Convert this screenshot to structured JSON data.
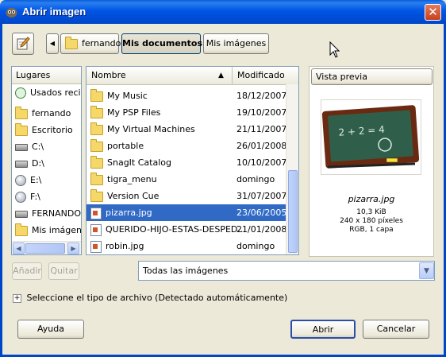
{
  "window": {
    "title": "Abrir imagen",
    "close_symbol": "✕"
  },
  "pathbar": {
    "back_arrow": "◀",
    "crumbs": [
      "fernando",
      "Mis documentos",
      "Mis imágenes"
    ]
  },
  "places": {
    "header": "Lugares",
    "items": [
      {
        "label": "Usados recien",
        "icon": "recent-icon"
      },
      {
        "label": "fernando",
        "icon": "folder-icon"
      },
      {
        "label": "Escritorio",
        "icon": "folder-icon"
      },
      {
        "label": "C:\\",
        "icon": "drive-icon"
      },
      {
        "label": "D:\\",
        "icon": "drive-icon"
      },
      {
        "label": "E:\\",
        "icon": "network-drive-icon"
      },
      {
        "label": "F:\\",
        "icon": "network-drive-icon"
      },
      {
        "label": "FERNANDO (C",
        "icon": "drive-icon"
      },
      {
        "label": "Mis imágenes",
        "icon": "folder-icon"
      }
    ],
    "add_button": "Añadir",
    "remove_button": "Quitar"
  },
  "files": {
    "col_name": "Nombre",
    "col_modified": "Modificado",
    "sort_arrow": "▲",
    "rows": [
      {
        "name": "My Music",
        "modified": "18/12/2007",
        "icon": "folder-icon",
        "selected": false
      },
      {
        "name": "My PSP Files",
        "modified": "19/10/2007",
        "icon": "folder-icon",
        "selected": false
      },
      {
        "name": "My Virtual Machines",
        "modified": "21/11/2007",
        "icon": "folder-icon",
        "selected": false
      },
      {
        "name": "portable",
        "modified": "26/01/2008",
        "icon": "folder-icon",
        "selected": false
      },
      {
        "name": "SnagIt Catalog",
        "modified": "10/10/2007",
        "icon": "folder-icon",
        "selected": false
      },
      {
        "name": "tigra_menu",
        "modified": "domingo",
        "icon": "folder-icon",
        "selected": false
      },
      {
        "name": "Version Cue",
        "modified": "31/07/2007",
        "icon": "folder-icon",
        "selected": false
      },
      {
        "name": "pizarra.jpg",
        "modified": "23/06/2005",
        "icon": "image-file-icon",
        "selected": true
      },
      {
        "name": "QUERIDO-HIJO-ESTAS-DESPED...",
        "modified": "21/01/2008",
        "icon": "image-file-icon",
        "selected": false
      },
      {
        "name": "robin.jpg",
        "modified": "domingo",
        "icon": "image-file-icon",
        "selected": false
      }
    ],
    "filter_value": "Todas las imágenes"
  },
  "preview": {
    "header": "Vista previa",
    "filename": "pizarra.jpg",
    "size": "10,3 KiB",
    "dimensions": "240 x 180 píxeles",
    "mode": "RGB, 1 capa",
    "board_text": "2 + 2 = 4"
  },
  "file_type": {
    "expander": "+",
    "label": "Seleccione el tipo de archivo (Detectado automáticamente)"
  },
  "actions": {
    "help": "Ayuda",
    "open": "Abrir",
    "cancel": "Cancelar"
  }
}
